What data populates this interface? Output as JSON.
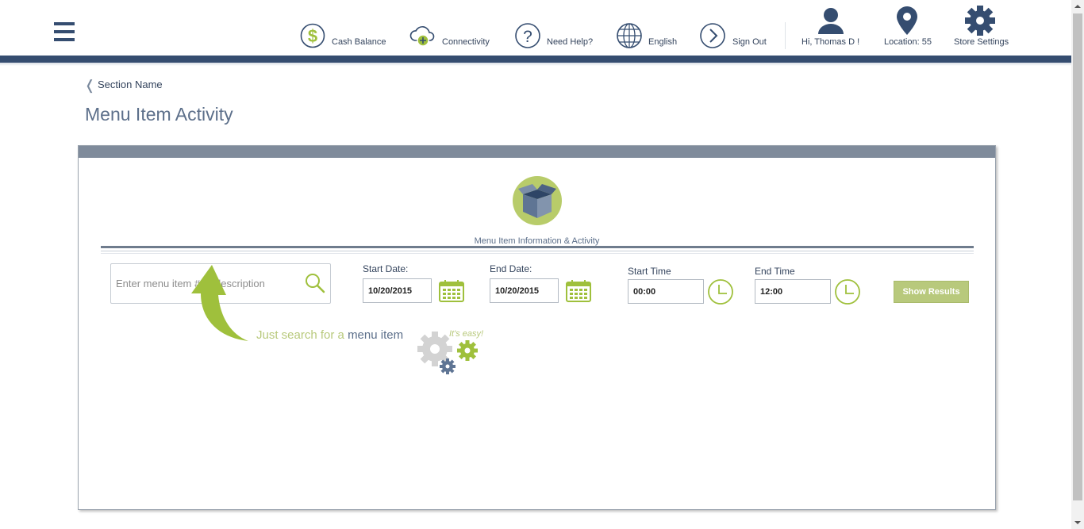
{
  "header": {
    "menu_icon": "hamburger-icon",
    "cash_balance": "Cash Balance",
    "connectivity": "Connectivity",
    "need_help": "Need Help?",
    "language": "English",
    "sign_out": "Sign Out",
    "user_greeting": "Hi,  Thomas D !",
    "location": "Location: 55",
    "store_settings": "Store Settings"
  },
  "breadcrumb": {
    "chevron": "❬",
    "label": "Section Name"
  },
  "page": {
    "title": "Menu Item Activity"
  },
  "panel": {
    "caption": "Menu Item Information & Activity",
    "search": {
      "placeholder": "Enter menu item # or description",
      "value": ""
    },
    "start_date": {
      "label": "Start Date:",
      "value": "10/20/2015"
    },
    "end_date": {
      "label": "End Date:",
      "value": "10/20/2015"
    },
    "start_time": {
      "label": "Start Time",
      "value": "00:00"
    },
    "end_time": {
      "label": "End Time",
      "value": "12:00"
    },
    "show_results": "Show Results",
    "hint": {
      "part1": "Just search for a ",
      "part2": "menu item",
      "easy": "It's easy!"
    }
  },
  "colors": {
    "navy": "#354d70",
    "accent_green": "#b8c97c",
    "title_gray_blue": "#5c6f8a"
  }
}
